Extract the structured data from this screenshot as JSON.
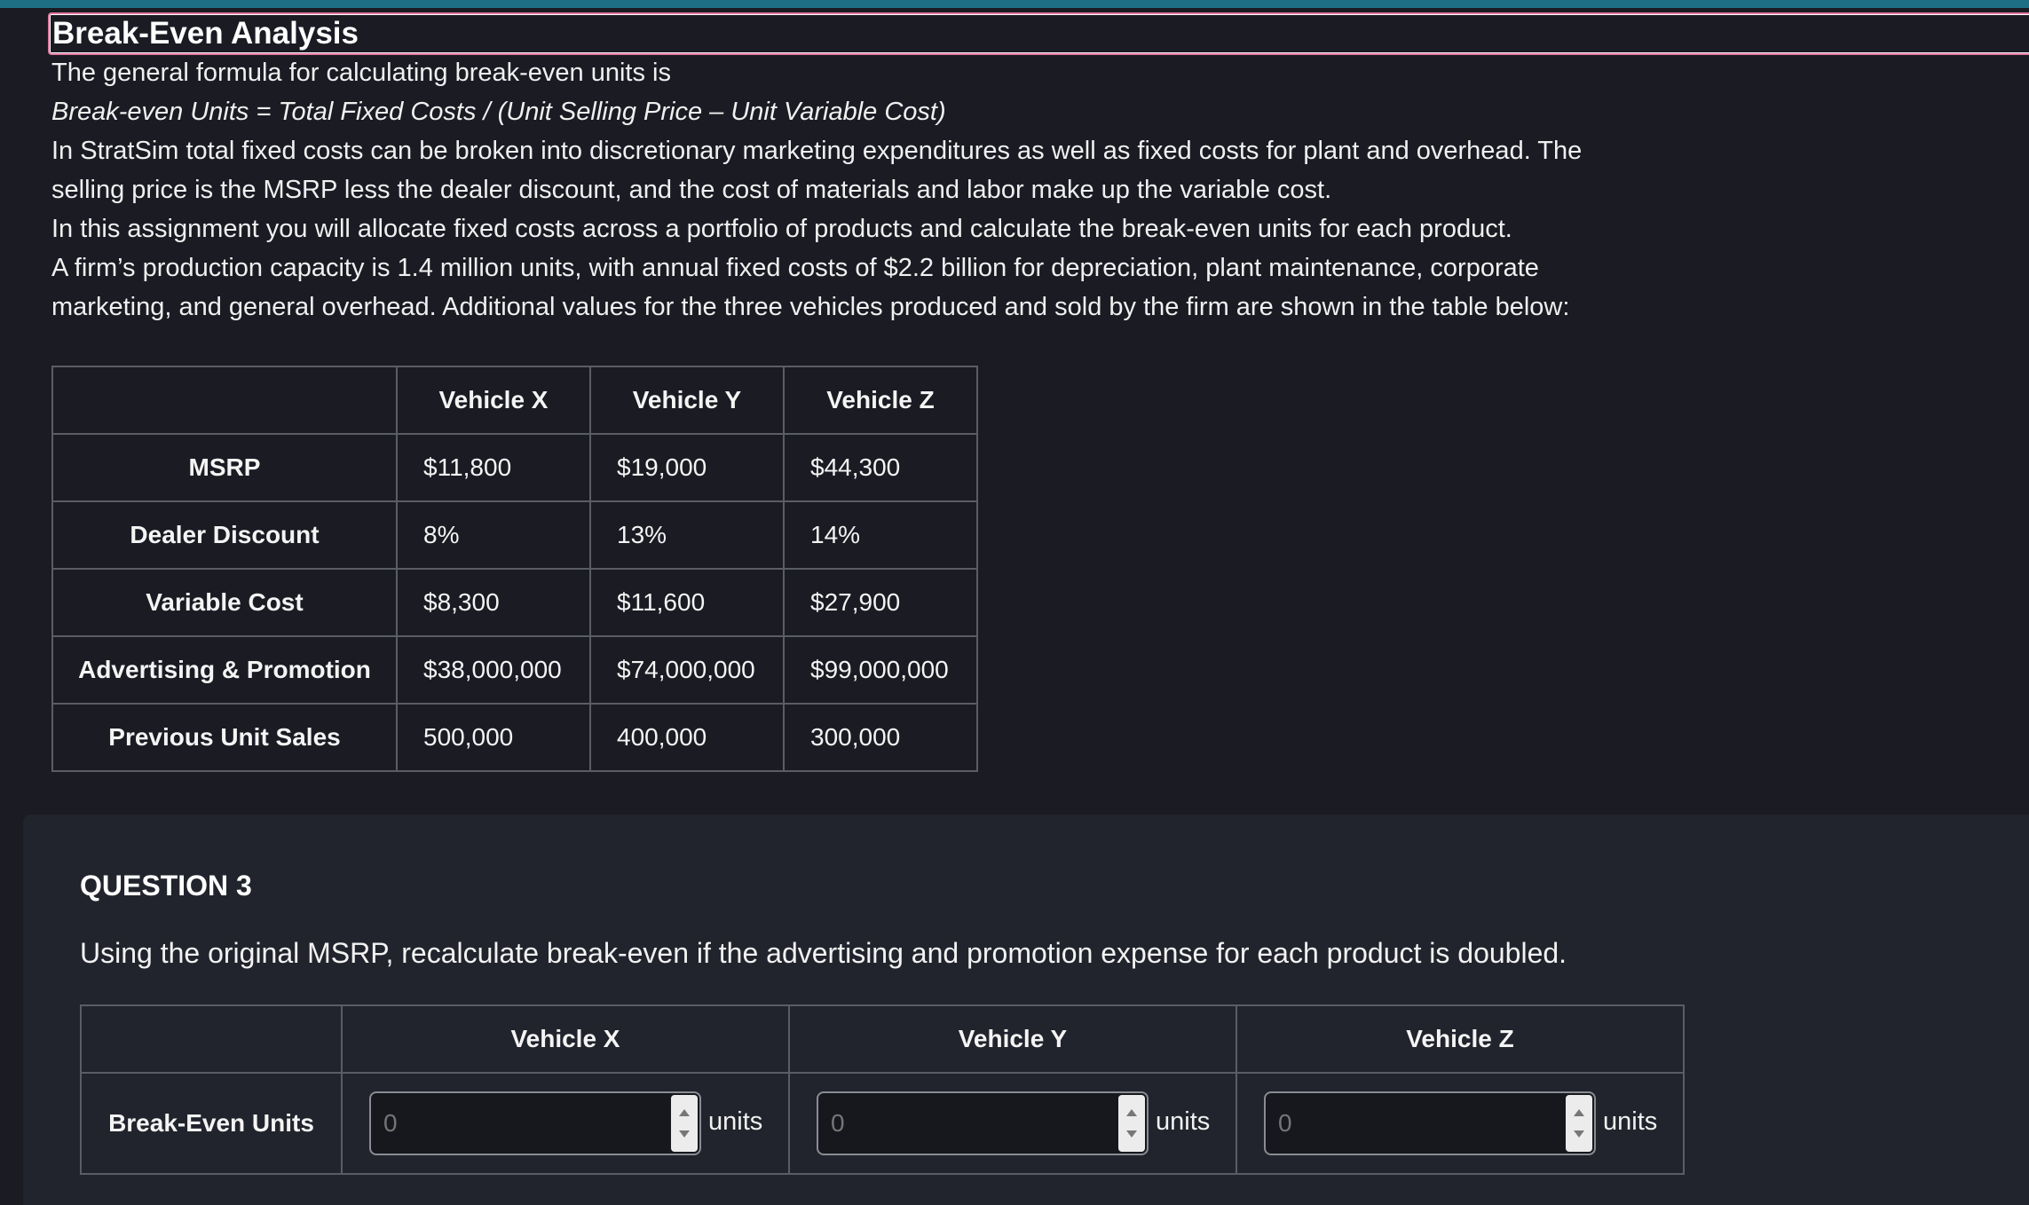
{
  "section": {
    "title": "Break-Even Analysis"
  },
  "intro": {
    "line1": "The general formula for calculating break-even units is",
    "formula": "Break-even Units = Total Fixed Costs / (Unit Selling Price – Unit Variable Cost)",
    "para1": "In StratSim total fixed costs can be broken into discretionary marketing expenditures as well as fixed costs for plant and overhead. The selling price is the MSRP less the dealer discount, and the cost of materials and labor make up the variable cost.",
    "para2": "In this assignment you will allocate fixed costs across a portfolio of products and calculate the break-even units for each product.",
    "para3": "A firm’s production capacity is 1.4 million units, with annual fixed costs of $2.2 billion for depreciation, plant maintenance, corporate marketing, and general overhead. Additional values for the three vehicles produced and sold by the firm are shown in the table below:"
  },
  "values_table": {
    "columns": [
      "Vehicle X",
      "Vehicle Y",
      "Vehicle Z"
    ],
    "rows": [
      {
        "label": "MSRP",
        "values": [
          "$11,800",
          "$19,000",
          "$44,300"
        ]
      },
      {
        "label": "Dealer Discount",
        "values": [
          "8%",
          "13%",
          "14%"
        ]
      },
      {
        "label": "Variable Cost",
        "values": [
          "$8,300",
          "$11,600",
          "$27,900"
        ]
      },
      {
        "label": "Advertising & Promotion",
        "values": [
          "$38,000,000",
          "$74,000,000",
          "$99,000,000"
        ]
      },
      {
        "label": "Previous Unit Sales",
        "values": [
          "500,000",
          "400,000",
          "300,000"
        ]
      }
    ]
  },
  "question": {
    "heading": "QUESTION 3",
    "text": "Using the original MSRP, recalculate break-even if the advertising and promotion expense for each product is doubled.",
    "columns": [
      "Vehicle X",
      "Vehicle Y",
      "Vehicle Z"
    ],
    "row_label": "Break-Even Units",
    "inputs": [
      {
        "value": "",
        "placeholder": "0"
      },
      {
        "value": "",
        "placeholder": "0"
      },
      {
        "value": "",
        "placeholder": "0"
      }
    ],
    "unit": "units"
  }
}
